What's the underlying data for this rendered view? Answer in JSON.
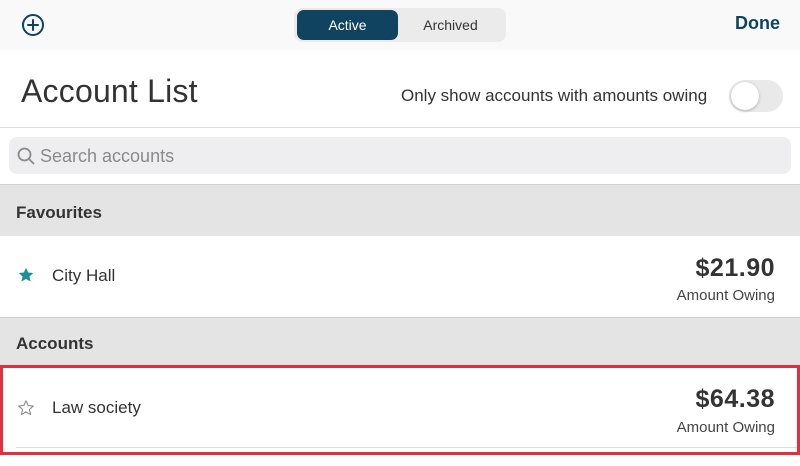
{
  "nav": {
    "add_icon": "plus-circle-icon",
    "tabs": [
      {
        "label": "Active",
        "selected": true
      },
      {
        "label": "Archived",
        "selected": false
      }
    ],
    "done_label": "Done"
  },
  "header": {
    "title": "Account List",
    "filter_label": "Only show accounts with amounts owing",
    "filter_on": false
  },
  "search": {
    "placeholder": "Search accounts",
    "icon": "search-icon"
  },
  "sections": {
    "favourites": {
      "title": "Favourites",
      "items": [
        {
          "name": "City Hall",
          "amount": "$21.90",
          "amount_label": "Amount Owing",
          "favourite": true
        }
      ]
    },
    "accounts": {
      "title": "Accounts",
      "items": [
        {
          "name": "Law society",
          "amount": "$64.38",
          "amount_label": "Amount Owing",
          "favourite": false
        }
      ]
    }
  },
  "colors": {
    "primary": "#0f4360",
    "star_filled": "#1a8f99",
    "highlight": "#e0303f",
    "section_bg": "#e4e4e4"
  }
}
